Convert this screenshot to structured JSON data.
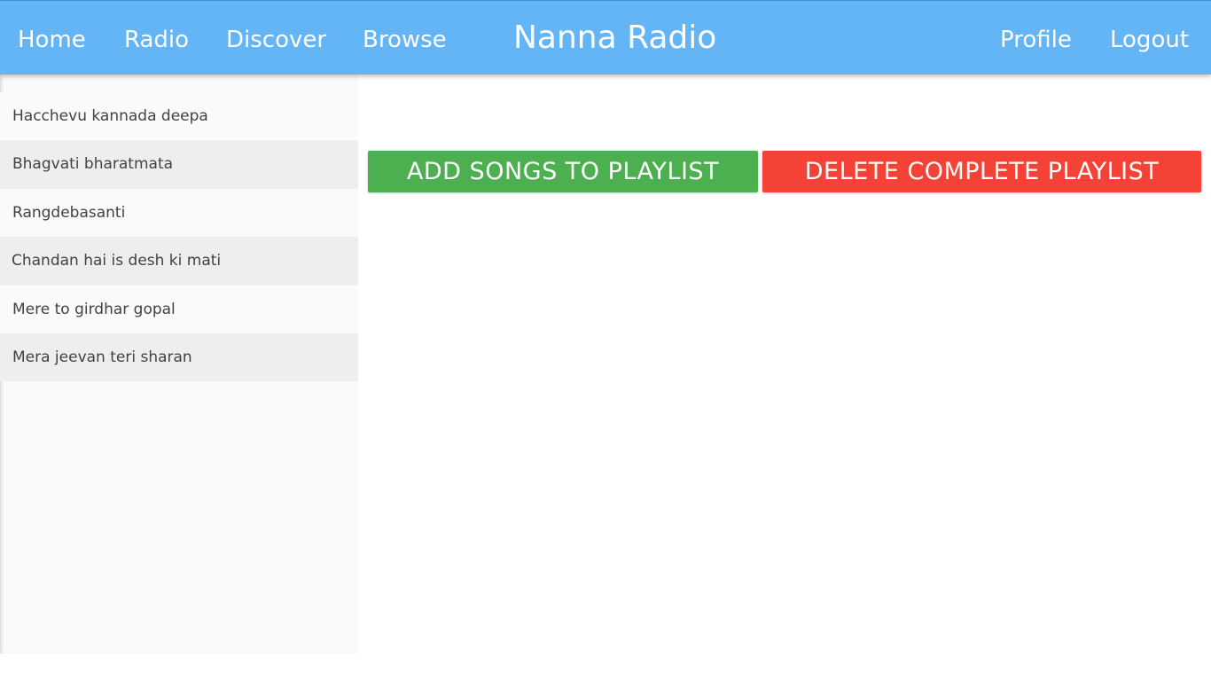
{
  "nav": {
    "home": "Home",
    "radio": "Radio",
    "discover": "Discover",
    "browse": "Browse",
    "brand": "Nanna Radio",
    "profile": "Profile",
    "logout": "Logout"
  },
  "playlist": {
    "songs": [
      "Hacchevu kannada deepa",
      "Bhagvati bharatmata",
      "Rangdebasanti",
      "Chandan hai is desh ki mati",
      "Mere to girdhar gopal",
      "Mera jeevan teri sharan"
    ]
  },
  "actions": {
    "add_label": "ADD SONGS TO PLAYLIST",
    "delete_label": "DELETE COMPLETE PLAYLIST"
  },
  "colors": {
    "topbar": "#64b5f6",
    "add_button": "#4caf50",
    "delete_button": "#f44336",
    "sidebar": "#fafafa",
    "sidebar_alt": "#eeeeee"
  }
}
